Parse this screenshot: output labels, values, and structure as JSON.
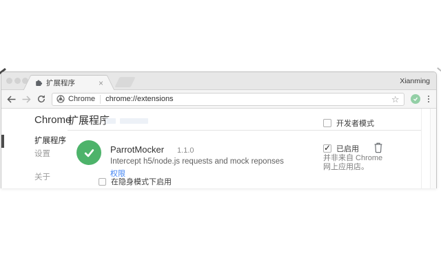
{
  "window": {
    "profile_name": "Xianming",
    "tab": {
      "title": "扩展程序",
      "close_glyph": "×"
    },
    "toolbar": {
      "omnibox": {
        "site_badge": "Chrome",
        "url": "chrome://extensions",
        "star_glyph": "☆"
      }
    }
  },
  "page": {
    "sidebar": {
      "brand": "Chrome",
      "items": [
        {
          "label": "扩展程序",
          "selected": true
        },
        {
          "label": "设置",
          "selected": false
        },
        {
          "label": "关于",
          "selected": false
        }
      ]
    },
    "header": {
      "title": "扩展程序",
      "developer_mode_label": "开发者模式"
    },
    "extension": {
      "name": "ParrotMocker",
      "version": "1.1.0",
      "description": "Intercept h5/node.js requests and mock reponses",
      "permissions_label": "权限",
      "incognito_label": "在隐身模式下启用",
      "enabled_label": "已启用",
      "enabled_checked": true,
      "enabled_check_glyph": "✓",
      "source_note_line1": "并非来自 Chrome",
      "source_note_line2": "网上应用店。"
    },
    "colors": {
      "extension_icon_green": "#4db36a",
      "toolbar_extension_green": "#93cfa6",
      "link_blue": "#4285f4",
      "sidebar_selected_indicator": "#4c4c4c"
    }
  }
}
